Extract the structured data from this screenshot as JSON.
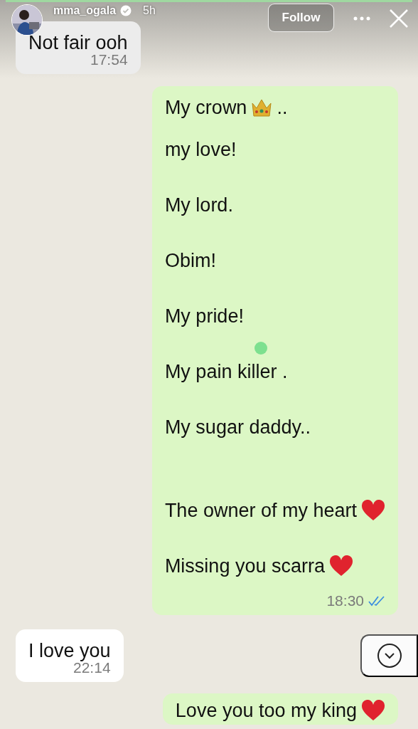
{
  "story_header": {
    "username": "mma_ogala",
    "verified": true,
    "age": "5h",
    "follow_button": "Follow",
    "progress": {
      "level": 1
    }
  },
  "messages": [
    {
      "kind": "received",
      "paragraphs": [
        {
          "lines": [
            {
              "kind": "plain",
              "text": "Not fair ooh"
            }
          ]
        }
      ],
      "time": "17:54"
    },
    {
      "kind": "sent",
      "paragraphs": [
        {
          "lines": [
            {
              "kind": "crown",
              "text": "My crown",
              "suffix": ".."
            },
            {
              "kind": "plain",
              "text": "my love!"
            },
            {
              "kind": "plain",
              "text": "My lord."
            },
            {
              "kind": "plain",
              "text": "Obim!"
            },
            {
              "kind": "plain",
              "text": "My pride!"
            },
            {
              "kind": "plain",
              "text": "My pain killer ."
            },
            {
              "kind": "plain",
              "text": "My sugar daddy.."
            }
          ]
        },
        {
          "lines": [
            {
              "kind": "heart",
              "text": "The owner of my heart"
            },
            {
              "kind": "heart",
              "text": "Missing you scarra"
            }
          ]
        }
      ],
      "time": "18:30",
      "read": true
    },
    {
      "kind": "received",
      "paragraphs": [
        {
          "lines": [
            {
              "kind": "plain",
              "text": "I love you"
            }
          ]
        }
      ],
      "time": "22:14"
    },
    {
      "kind": "sent",
      "paragraphs": [
        {
          "lines": [
            {
              "kind": "heart",
              "text": "Love you too my king"
            }
          ]
        }
      ]
    }
  ]
}
